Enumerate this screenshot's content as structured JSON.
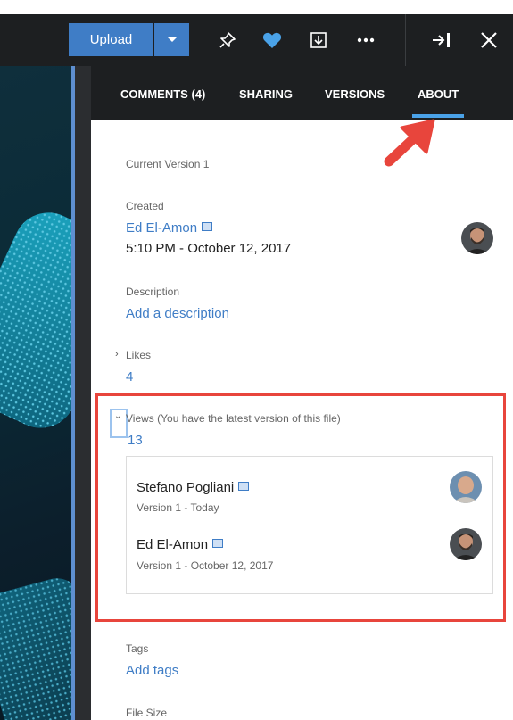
{
  "toolbar": {
    "upload_label": "Upload",
    "icons": [
      "chevron-down-icon",
      "pin-icon",
      "heart-icon",
      "download-icon",
      "more-icon",
      "collapse-panel-icon",
      "close-icon"
    ]
  },
  "tabs": [
    {
      "label": "COMMENTS (4)"
    },
    {
      "label": "SHARING"
    },
    {
      "label": "VERSIONS"
    },
    {
      "label": "ABOUT",
      "active": true
    }
  ],
  "about": {
    "current_version": "Current Version 1",
    "created_label": "Created",
    "created_by": "Ed El-Amon",
    "created_at": "5:10 PM - October 12, 2017",
    "description_label": "Description",
    "description_link": "Add a description",
    "likes_label": "Likes",
    "likes_count": "4",
    "views_label": "Views (You have the latest version of this file)",
    "views_count": "13",
    "viewers": [
      {
        "name": "Stefano Pogliani",
        "version": "Version 1 - Today"
      },
      {
        "name": "Ed El-Amon",
        "version": "Version 1 - October 12, 2017"
      }
    ],
    "tags_label": "Tags",
    "tags_link": "Add tags",
    "file_size_label": "File Size"
  },
  "colors": {
    "toolbar_bg": "#1d1f21",
    "accent_blue": "#3f7dc6",
    "active_tab_underline": "#4aa2e8",
    "highlight_red": "#e8453c"
  }
}
